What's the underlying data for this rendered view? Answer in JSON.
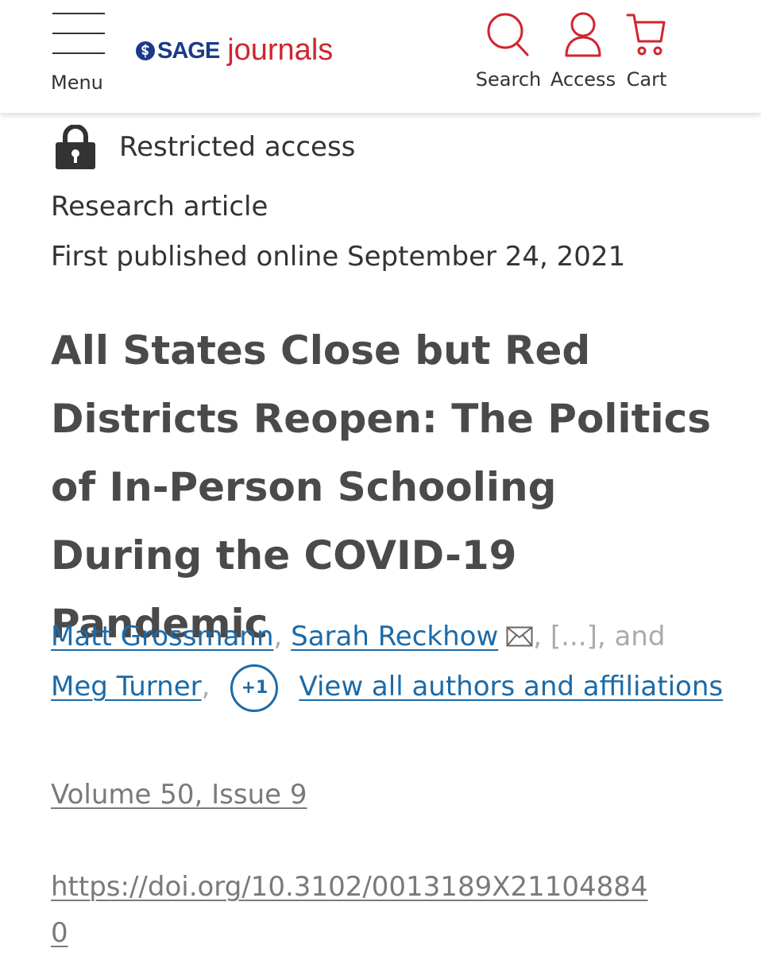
{
  "header": {
    "menu_label": "Menu",
    "logo_sage": "SAGE",
    "logo_journals": "journals",
    "nav": {
      "search_label": "Search",
      "access_label": "Access",
      "cart_label": "Cart"
    },
    "colors": {
      "brand_blue": "#1b3a8b",
      "brand_red": "#d0252e"
    },
    "icons": [
      "hamburger-menu-icon",
      "search-icon",
      "user-icon",
      "cart-icon"
    ]
  },
  "access": {
    "label": "Restricted access",
    "icon": "lock-icon"
  },
  "article": {
    "type": "Research article",
    "published": "First published online September 24, 2021",
    "title": "All States Close but Red Districts Reopen: The Politics of In-Person Schooling During the COVID-19 Pandemic",
    "authors": [
      {
        "name": "Matt Grossmann",
        "separator": ","
      },
      {
        "name": "Sarah Reckhow",
        "separator": ",",
        "icon": "mail-icon"
      },
      {
        "name": "Meg Turner",
        "separator": ","
      }
    ],
    "ellipsis_text": "[...], and",
    "more_authors_badge": "+1",
    "view_all_link": "View all authors and affiliations",
    "volume": "Volume 50, Issue 9",
    "doi": "https://doi.org/10.3102/0013189X211048840",
    "link_color": "#1b6aa8"
  }
}
